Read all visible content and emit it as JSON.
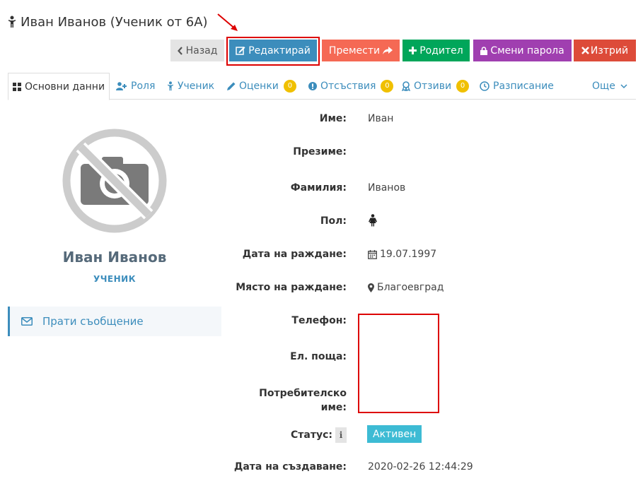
{
  "header": {
    "title": "Иван Иванов (Ученик от 6А)",
    "title_icon": "child-icon"
  },
  "toolbar": {
    "back_label": "Назад",
    "edit_label": "Редактирай",
    "move_label": "Премести",
    "parent_label": "Родител",
    "password_label": "Смени парола",
    "delete_label": "Изтрий"
  },
  "tabs": [
    {
      "label": "Основни данни",
      "icon": "grid-icon",
      "active": true
    },
    {
      "label": "Роля",
      "icon": "user-plus-icon"
    },
    {
      "label": "Ученик",
      "icon": "child-icon"
    },
    {
      "label": "Оценки",
      "icon": "pencil-icon",
      "badge": "0"
    },
    {
      "label": "Отсъствия",
      "icon": "exclamation-circle-icon",
      "badge": "0"
    },
    {
      "label": "Отзиви",
      "icon": "award-icon",
      "badge": "0"
    },
    {
      "label": "Разписание",
      "icon": "clock-icon"
    },
    {
      "label": "Още",
      "icon": "chevron-down-icon"
    }
  ],
  "profile": {
    "name": "Иван Иванов",
    "role": "УЧЕНИК",
    "message_label": "Прати съобщение"
  },
  "fields": {
    "first_name": {
      "label": "Име:",
      "value": "Иван"
    },
    "middle_name": {
      "label": "Презиме:",
      "value": ""
    },
    "last_name": {
      "label": "Фамилия:",
      "value": "Иванов"
    },
    "gender": {
      "label": "Пол:",
      "icon": "female-icon"
    },
    "birth_date": {
      "label": "Дата на раждане:",
      "value": "19.07.1997"
    },
    "birth_place": {
      "label": "Място на раждане:",
      "value": "Благоевград"
    },
    "phone": {
      "label": "Телефон:",
      "value": ""
    },
    "email": {
      "label": "Ел. поща:",
      "value": ""
    },
    "username": {
      "label_line1": "Потребителско",
      "label_line2": "име:",
      "value": ""
    },
    "status": {
      "label": "Статус:",
      "value": "Активен",
      "info_icon": "i"
    },
    "created": {
      "label": "Дата на създаване:",
      "value": "2020-02-26 12:44:29"
    }
  },
  "colors": {
    "primary": "#3c8dbc",
    "danger": "#dd4b39",
    "success": "#00a65a",
    "purple": "#a03fb0",
    "info": "#3dbbd4",
    "highlight": "#dd0000"
  }
}
